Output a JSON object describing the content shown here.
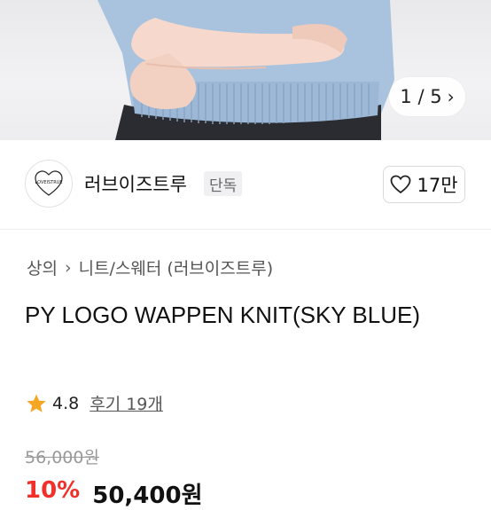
{
  "gallery": {
    "counter": "1 / 5"
  },
  "store": {
    "name": "러브이즈트루",
    "badge": "단독",
    "likes": "17만",
    "logo_text": "LOVEISTRUE"
  },
  "product": {
    "breadcrumb": [
      "상의",
      "니트/스웨터 (러브이즈트루)"
    ],
    "title": "PY LOGO WAPPEN KNIT(SKY BLUE)",
    "rating": "4.8",
    "review_link": "후기 19개",
    "original_price": "56,000원",
    "discount": "10%",
    "price": "50,400원"
  },
  "colors": {
    "accent_red": "#f2302a",
    "star": "#f5a623",
    "knit": "#a9c3df"
  }
}
